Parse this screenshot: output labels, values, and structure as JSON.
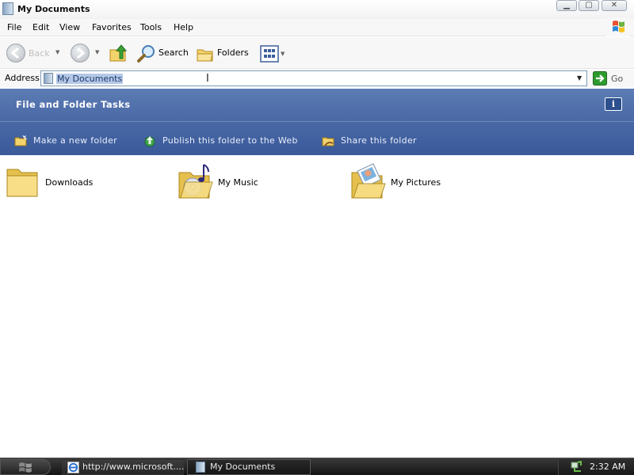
{
  "window": {
    "title": "My Documents"
  },
  "menu": [
    "File",
    "Edit",
    "View",
    "Favorites",
    "Tools",
    "Help"
  ],
  "toolbar": {
    "back_label": "Back",
    "search_label": "Search",
    "folders_label": "Folders"
  },
  "address": {
    "label": "Address",
    "value": "My Documents",
    "go_label": "Go"
  },
  "tasks": {
    "title": "File and Folder Tasks",
    "items": [
      "Make a new folder",
      "Publish this folder to the Web",
      "Share this folder"
    ]
  },
  "folders": [
    "Downloads",
    "My Music",
    "My Pictures"
  ],
  "taskbar": {
    "items": [
      "http://www.microsoft....",
      "My Documents"
    ],
    "clock": "2:32 AM"
  },
  "colors": {
    "task_pane": "#4b6aa6",
    "selection": "#b5c8e6",
    "go_arrow": "#2e9a2e"
  }
}
